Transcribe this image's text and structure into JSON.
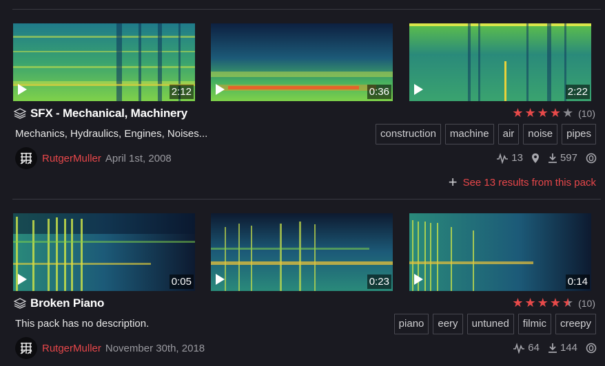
{
  "packs": [
    {
      "title": "SFX - Mechanical, Machinery",
      "description": "Mechanics, Hydraulics, Engines, Noises...",
      "rating_count": "(10)",
      "stars_filled": 4,
      "tags": [
        "construction",
        "machine",
        "air",
        "noise",
        "pipes"
      ],
      "author": "RutgerMuller",
      "date": "April 1st, 2008",
      "stats": {
        "sounds": "13",
        "downloads": "597"
      },
      "see_more": "See 13 results from this pack",
      "sounds": [
        {
          "duration": "2:12"
        },
        {
          "duration": "0:36"
        },
        {
          "duration": "2:22"
        }
      ]
    },
    {
      "title": "Broken Piano",
      "description": "This pack has no description.",
      "rating_count": "(10)",
      "stars_filled": 4.5,
      "tags": [
        "piano",
        "eery",
        "untuned",
        "filmic",
        "creepy"
      ],
      "author": "RutgerMuller",
      "date": "November 30th, 2018",
      "stats": {
        "sounds": "64",
        "downloads": "144"
      },
      "sounds": [
        {
          "duration": "0:05"
        },
        {
          "duration": "0:23"
        },
        {
          "duration": "0:14"
        }
      ]
    }
  ],
  "icons": [
    "play-icon",
    "layers-icon",
    "star-icon",
    "waveform-icon",
    "location-icon",
    "download-icon",
    "license-icon",
    "plus-icon"
  ],
  "colors": {
    "accent": "#e8474a",
    "background": "#1a1a21",
    "star": "#e84a4a"
  }
}
